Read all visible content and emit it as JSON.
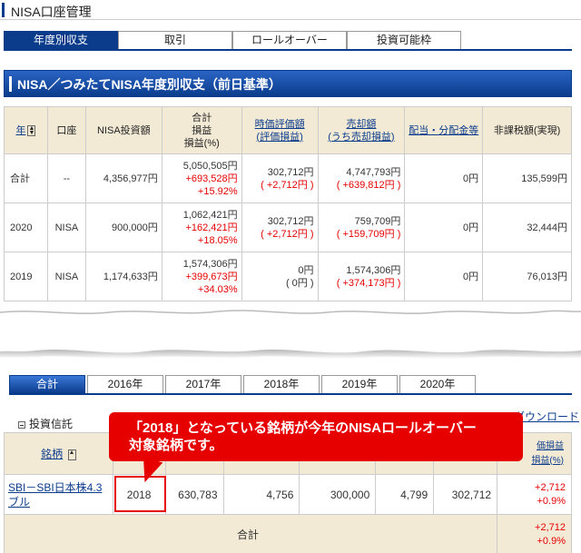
{
  "page": {
    "title": "NISA口座管理"
  },
  "tabs_top": [
    "年度別収支",
    "取引",
    "ロールオーバー",
    "投資可能枠"
  ],
  "section1": {
    "title": "NISA／つみたてNISA年度別収支（前日基準）"
  },
  "table1": {
    "headers": {
      "year": "年",
      "account": "口座",
      "invest": "NISA投資額",
      "total_l1": "合計",
      "total_l2": "損益",
      "total_l3": "損益(%)",
      "eval_l1": "時価評価額",
      "eval_l2": "(評価損益)",
      "sell_l1": "売却額",
      "sell_l2": "(うち売却損益)",
      "dividend": "配当・分配金等",
      "tax": "非課税額(実現)"
    },
    "rows": [
      {
        "year": "合計",
        "account": "--",
        "invest": "4,356,977円",
        "total": "5,050,505円",
        "gain": "+693,528円",
        "pct": "+15.92%",
        "eval": "302,712円",
        "eval_gain": "( +2,712円 )",
        "sell": "4,747,793円",
        "sell_gain": "( +639,812円 )",
        "dividend": "0円",
        "tax": "135,599円"
      },
      {
        "year": "2020",
        "account": "NISA",
        "invest": "900,000円",
        "total": "1,062,421円",
        "gain": "+162,421円",
        "pct": "+18.05%",
        "eval": "302,712円",
        "eval_gain": "( +2,712円 )",
        "sell": "759,709円",
        "sell_gain": "( +159,709円 )",
        "dividend": "0円",
        "tax": "32,444円"
      },
      {
        "year": "2019",
        "account": "NISA",
        "invest": "1,174,633円",
        "total": "1,574,306円",
        "gain": "+399,673円",
        "pct": "+34.03%",
        "eval": "0円",
        "eval_gain": "( 0円 )",
        "sell": "1,574,306円",
        "sell_gain": "( +374,173円 )",
        "dividend": "0円",
        "tax": "76,013円"
      }
    ]
  },
  "tabs_year": [
    "合計",
    "2016年",
    "2017年",
    "2018年",
    "2019年",
    "2020年"
  ],
  "sub_section": {
    "title": "投資信託",
    "download": "ダウンロード"
  },
  "table2": {
    "header_name": "銘柄",
    "header_right_l1": "価損益",
    "header_right_l2": "損益(%)",
    "row": {
      "name": "SBI－SBI日本株4.3ブル",
      "year": "2018",
      "c1": "630,783",
      "c2": "4,756",
      "c3": "300,000",
      "c4": "4,799",
      "c5": "302,712",
      "gain": "+2,712",
      "pct": "+0.9%"
    },
    "total": {
      "label": "合計",
      "gain": "+2,712",
      "pct": "+0.9%"
    }
  },
  "callout": {
    "line1": "「2018」となっている銘柄が今年のNISAロールオーバー",
    "line2": "対象銘柄です。"
  },
  "colors": {
    "brand": "#0b3c8c",
    "header_bg": "#f3ead6",
    "accent_red": "#e60000"
  }
}
